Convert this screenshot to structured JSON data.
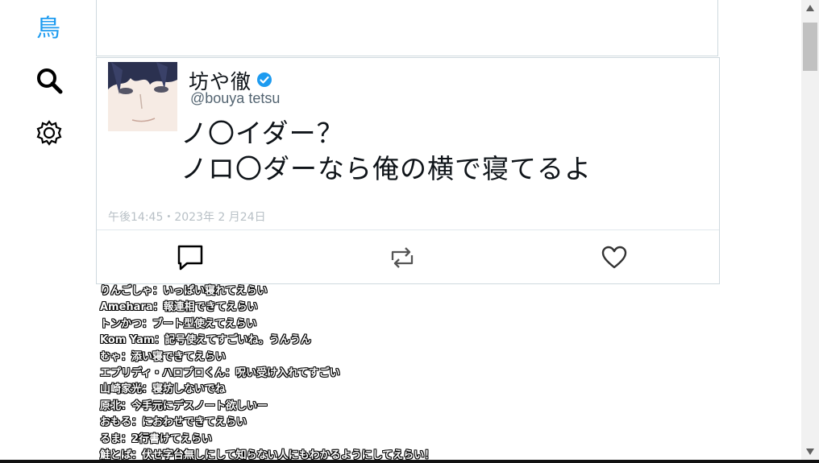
{
  "sidebar": {
    "logo_text": "鳥",
    "search_icon": "search-icon",
    "settings_icon": "gear-icon"
  },
  "tweet": {
    "display_name": "坊や徹",
    "verified": true,
    "handle": "@bouya tetsu",
    "text_line1": "ノ〇イダー？",
    "text_line2": "ノロ〇ダーなら俺の横で寝てるよ",
    "timestamp": "午後14:45・2023年 2 月24日",
    "actions": [
      "reply-icon",
      "retweet-icon",
      "heart-icon"
    ]
  },
  "comments": [
    "りんごしゃ：いっぱい寝れてえらい",
    "Amehara：報連相できてえらい",
    "トンかつ：ブート型使えてえらい",
    "Kom Yam：記号使えてすごいね。うんうん",
    "むゃ：添い寝できてえらい",
    "エプリディ・ハロプロくん：呪い受け入れてすごい",
    "山崎家光：寝坊しないでね",
    "原北：今手元にデスノート欲しいー",
    "おもる：におわせできてえらい",
    "るま：2行書けてえらい",
    "鮭とば：伏せ字台無しにして知らない人にもわかるようにしてえらい！"
  ],
  "colors": {
    "accent": "#1d9bf0",
    "verified": "#1d9bf0",
    "border": "#cfd9de"
  }
}
